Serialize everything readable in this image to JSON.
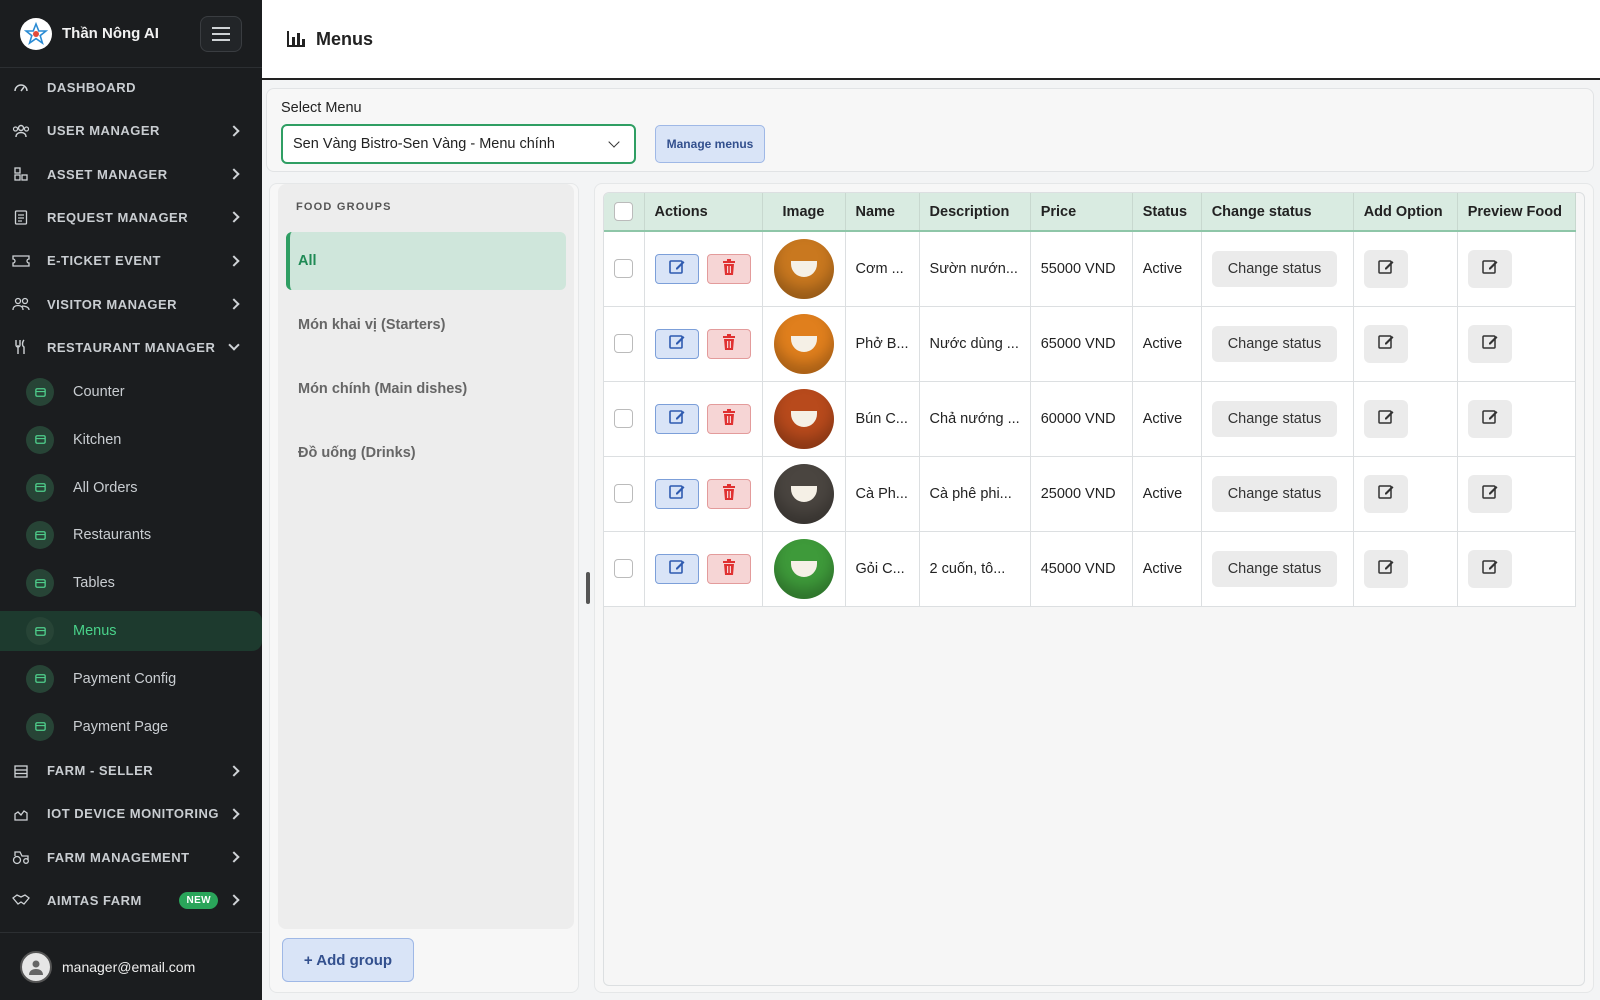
{
  "brand": {
    "name": "Thần Nông AI"
  },
  "nav": [
    {
      "label": "DASHBOARD",
      "icon": "dashboard-icon",
      "chevron": "none"
    },
    {
      "label": "USER MANAGER",
      "icon": "users-icon",
      "chevron": "right"
    },
    {
      "label": "ASSET MANAGER",
      "icon": "asset-icon",
      "chevron": "right"
    },
    {
      "label": "REQUEST MANAGER",
      "icon": "clipboard-icon",
      "chevron": "right"
    },
    {
      "label": "E-TICKET EVENT",
      "icon": "ticket-icon",
      "chevron": "right"
    },
    {
      "label": "VISITOR MANAGER",
      "icon": "visitor-icon",
      "chevron": "right"
    },
    {
      "label": "RESTAURANT MANAGER",
      "icon": "fork-knife-icon",
      "chevron": "down"
    }
  ],
  "restaurant_sub": [
    {
      "label": "Counter",
      "icon": "counter-icon"
    },
    {
      "label": "Kitchen",
      "icon": "flame-icon"
    },
    {
      "label": "All Orders",
      "icon": "orders-icon"
    },
    {
      "label": "Restaurants",
      "icon": "store-icon"
    },
    {
      "label": "Tables",
      "icon": "chair-icon"
    },
    {
      "label": "Menus",
      "icon": "menu-book-icon",
      "active": true
    },
    {
      "label": "Payment Config",
      "icon": "payment-config-icon"
    },
    {
      "label": "Payment Page",
      "icon": "card-icon"
    }
  ],
  "nav_bottom": [
    {
      "label": "FARM - SELLER",
      "icon": "seller-icon",
      "chevron": "right"
    },
    {
      "label": "IOT DEVICE MONITORING",
      "icon": "chart-icon",
      "chevron": "right"
    },
    {
      "label": "FARM MANAGEMENT",
      "icon": "tractor-icon",
      "chevron": "right"
    },
    {
      "label": "AIMTAS FARM",
      "icon": "handshake-icon",
      "chevron": "right",
      "badge": "NEW"
    }
  ],
  "user": {
    "email": "manager@email.com"
  },
  "header": {
    "title": "Menus"
  },
  "select_menu": {
    "label": "Select Menu",
    "value": "Sen Vàng Bistro-Sen Vàng - Menu chính",
    "manage_label": "Manage menus"
  },
  "food_groups": {
    "title": "FOOD GROUPS",
    "items": [
      {
        "label": "All",
        "active": true
      },
      {
        "label": "Món khai vị (Starters)"
      },
      {
        "label": "Món chính (Main dishes)"
      },
      {
        "label": "Đồ uống (Drinks)"
      }
    ],
    "add_label": "+ Add group"
  },
  "table": {
    "columns": [
      "Actions",
      "Image",
      "Name",
      "Description",
      "Price",
      "Status",
      "Change status",
      "Add Option",
      "Preview Food"
    ],
    "rows": [
      {
        "name": "Cơm ...",
        "description": "Sườn nướn...",
        "price": "55000 VND",
        "status": "Active",
        "change_label": "Change status",
        "img_color": "#c9781f"
      },
      {
        "name": "Phở B...",
        "description": "Nước dùng ...",
        "price": "65000 VND",
        "status": "Active",
        "change_label": "Change status",
        "img_color": "#e07f1d"
      },
      {
        "name": "Bún C...",
        "description": "Chả nướng ...",
        "price": "60000 VND",
        "status": "Active",
        "change_label": "Change status",
        "img_color": "#b84a1c"
      },
      {
        "name": "Cà Ph...",
        "description": "Cà phê phi...",
        "price": "25000 VND",
        "status": "Active",
        "change_label": "Change status",
        "img_color": "#4a4540"
      },
      {
        "name": "Gỏi C...",
        "description": "2 cuốn, tô...",
        "price": "45000 VND",
        "status": "Active",
        "change_label": "Change status",
        "img_color": "#3e9a3a"
      }
    ]
  },
  "colors": {
    "accent": "#2f9e63",
    "sidebar_bg": "#1b1d1f",
    "header_cell": "#d9ebe1"
  }
}
